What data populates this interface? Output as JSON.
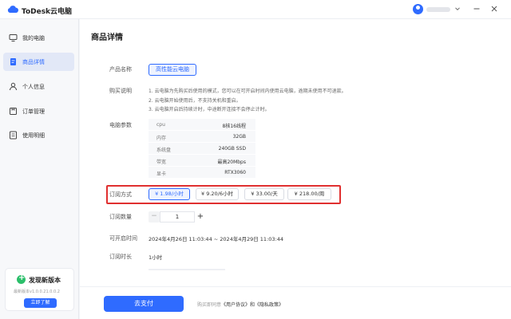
{
  "app": {
    "title": "ToDesk云电脑",
    "brand_color": "#2f6bff"
  },
  "sidebar": {
    "items": [
      {
        "label": "我的电脑",
        "icon": "monitor-icon",
        "active": false
      },
      {
        "label": "商品详情",
        "icon": "document-icon",
        "active": true
      },
      {
        "label": "个人信息",
        "icon": "user-icon",
        "active": false
      },
      {
        "label": "订单管理",
        "icon": "order-icon",
        "active": false
      },
      {
        "label": "使用明细",
        "icon": "list-icon",
        "active": false
      }
    ]
  },
  "update_card": {
    "title": "发现新版本",
    "version_text": "最新版本v1.0.0.21.0.0.2",
    "button_label": "立即了解"
  },
  "page": {
    "title": "商品详情",
    "product_name_label": "产品名称",
    "product_name": "高性能云电脑",
    "purchase_desc_label": "购买说明",
    "purchase_desc": [
      "1. 云电脑为先购买后使用的模式，您可以在可开启时间内使用云电脑，逾期未使用不可退款。",
      "2. 云电脑开始使用后，不支持关机和重启。",
      "3. 云电脑开启后持续计时，中途断开连接不会停止计时。"
    ],
    "specs_label": "电脑参数",
    "specs": [
      {
        "key": "cpu",
        "value": "8核16线程"
      },
      {
        "key": "内存",
        "value": "32GB"
      },
      {
        "key": "系统盘",
        "value": "240GB SSD"
      },
      {
        "key": "带宽",
        "value": "最高20Mbps"
      },
      {
        "key": "显卡",
        "value": "RTX3060"
      }
    ],
    "subscription_label": "订阅方式",
    "subscription_options": [
      {
        "label": "¥ 1.98/小时",
        "selected": true
      },
      {
        "label": "¥ 9.20/6小时",
        "selected": false
      },
      {
        "label": "¥ 33.00/天",
        "selected": false
      },
      {
        "label": "¥ 218.00/周",
        "selected": false
      }
    ],
    "quantity_label": "订阅数量",
    "quantity": "1",
    "open_time_label": "可开启时间",
    "open_time": "2024年4月26日 11:03:44 ~ 2024年4月29日 11:03:44",
    "duration_label": "订阅时长",
    "duration": "1小时"
  },
  "footer": {
    "pay_label": "去支付",
    "agree_prefix": "购买即同意",
    "agree_links": "《用户协议》和《隐私政策》"
  }
}
